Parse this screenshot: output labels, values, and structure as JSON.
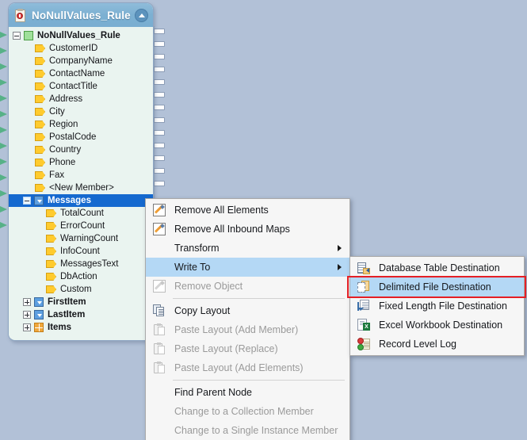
{
  "node_panel": {
    "header": {
      "title": "NoNullValues_Rule",
      "icon": "clipboard-record-icon",
      "collapse_icon": "chevron-up-icon"
    },
    "tree": [
      {
        "label": "NoNullValues_Rule",
        "icon": "green-square-icon",
        "expander": "minus",
        "depth": 0,
        "selected": false,
        "bold": true
      },
      {
        "label": "CustomerID",
        "icon": "yellow-pentagon-icon",
        "expander": "none",
        "depth": 1,
        "selected": false,
        "bold": false
      },
      {
        "label": "CompanyName",
        "icon": "yellow-pentagon-icon",
        "expander": "none",
        "depth": 1,
        "selected": false,
        "bold": false
      },
      {
        "label": "ContactName",
        "icon": "yellow-pentagon-icon",
        "expander": "none",
        "depth": 1,
        "selected": false,
        "bold": false
      },
      {
        "label": "ContactTitle",
        "icon": "yellow-pentagon-icon",
        "expander": "none",
        "depth": 1,
        "selected": false,
        "bold": false
      },
      {
        "label": "Address",
        "icon": "yellow-pentagon-icon",
        "expander": "none",
        "depth": 1,
        "selected": false,
        "bold": false
      },
      {
        "label": "City",
        "icon": "yellow-pentagon-icon",
        "expander": "none",
        "depth": 1,
        "selected": false,
        "bold": false
      },
      {
        "label": "Region",
        "icon": "yellow-pentagon-icon",
        "expander": "none",
        "depth": 1,
        "selected": false,
        "bold": false
      },
      {
        "label": "PostalCode",
        "icon": "yellow-pentagon-icon",
        "expander": "none",
        "depth": 1,
        "selected": false,
        "bold": false
      },
      {
        "label": "Country",
        "icon": "yellow-pentagon-icon",
        "expander": "none",
        "depth": 1,
        "selected": false,
        "bold": false
      },
      {
        "label": "Phone",
        "icon": "yellow-pentagon-icon",
        "expander": "none",
        "depth": 1,
        "selected": false,
        "bold": false
      },
      {
        "label": "Fax",
        "icon": "yellow-pentagon-icon",
        "expander": "none",
        "depth": 1,
        "selected": false,
        "bold": false
      },
      {
        "label": "<New Member>",
        "icon": "yellow-pentagon-icon",
        "expander": "none",
        "depth": 1,
        "selected": false,
        "bold": false
      },
      {
        "label": "Messages",
        "icon": "blue-node-icon",
        "expander": "minus",
        "depth": 1,
        "selected": true,
        "bold": true
      },
      {
        "label": "TotalCount",
        "icon": "yellow-pentagon-icon",
        "expander": "none",
        "depth": 2,
        "selected": false,
        "bold": false
      },
      {
        "label": "ErrorCount",
        "icon": "yellow-pentagon-icon",
        "expander": "none",
        "depth": 2,
        "selected": false,
        "bold": false
      },
      {
        "label": "WarningCount",
        "icon": "yellow-pentagon-icon",
        "expander": "none",
        "depth": 2,
        "selected": false,
        "bold": false
      },
      {
        "label": "InfoCount",
        "icon": "yellow-pentagon-icon",
        "expander": "none",
        "depth": 2,
        "selected": false,
        "bold": false
      },
      {
        "label": "MessagesText",
        "icon": "yellow-pentagon-icon",
        "expander": "none",
        "depth": 2,
        "selected": false,
        "bold": false
      },
      {
        "label": "DbAction",
        "icon": "yellow-pentagon-icon",
        "expander": "none",
        "depth": 2,
        "selected": false,
        "bold": false
      },
      {
        "label": "Custom",
        "icon": "yellow-pentagon-icon",
        "expander": "none",
        "depth": 2,
        "selected": false,
        "bold": false
      },
      {
        "label": "FirstItem",
        "icon": "blue-node-icon",
        "expander": "plus",
        "depth": 1,
        "selected": false,
        "bold": true
      },
      {
        "label": "LastItem",
        "icon": "blue-node-icon",
        "expander": "plus",
        "depth": 1,
        "selected": false,
        "bold": true
      },
      {
        "label": "Items",
        "icon": "orange-grid-icon",
        "expander": "plus",
        "depth": 1,
        "selected": false,
        "bold": true
      }
    ]
  },
  "context_menu": [
    {
      "label": "Remove All Elements",
      "icon": "pencil-icon",
      "disabled": false,
      "submenu": false,
      "highlighted": false,
      "separator_after": false
    },
    {
      "label": "Remove All Inbound Maps",
      "icon": "pencil-icon",
      "disabled": false,
      "submenu": false,
      "highlighted": false,
      "separator_after": false
    },
    {
      "label": "Transform",
      "icon": "none",
      "disabled": false,
      "submenu": true,
      "highlighted": false,
      "separator_after": false
    },
    {
      "label": "Write To",
      "icon": "none",
      "disabled": false,
      "submenu": true,
      "highlighted": true,
      "separator_after": false
    },
    {
      "label": "Remove Object",
      "icon": "pencil-dim-icon",
      "disabled": true,
      "submenu": false,
      "highlighted": false,
      "separator_after": true
    },
    {
      "label": "Copy Layout",
      "icon": "copy-icon",
      "disabled": false,
      "submenu": false,
      "highlighted": false,
      "separator_after": false
    },
    {
      "label": "Paste Layout (Add Member)",
      "icon": "paste-icon",
      "disabled": true,
      "submenu": false,
      "highlighted": false,
      "separator_after": false
    },
    {
      "label": "Paste Layout (Replace)",
      "icon": "paste-icon",
      "disabled": true,
      "submenu": false,
      "highlighted": false,
      "separator_after": false
    },
    {
      "label": "Paste Layout (Add Elements)",
      "icon": "paste-icon",
      "disabled": true,
      "submenu": false,
      "highlighted": false,
      "separator_after": true
    },
    {
      "label": "Find Parent Node",
      "icon": "none",
      "disabled": false,
      "submenu": false,
      "highlighted": false,
      "separator_after": false
    },
    {
      "label": "Change to a Collection Member",
      "icon": "none",
      "disabled": true,
      "submenu": false,
      "highlighted": false,
      "separator_after": false
    },
    {
      "label": "Change to a Single Instance Member",
      "icon": "none",
      "disabled": true,
      "submenu": false,
      "highlighted": false,
      "separator_after": false
    }
  ],
  "submenu": {
    "parent": "Write To",
    "items": [
      {
        "label": "Database Table Destination",
        "icon": "database-table-icon",
        "highlighted": false,
        "outlined": false
      },
      {
        "label": "Delimited File Destination",
        "icon": "delimited-file-icon",
        "highlighted": true,
        "outlined": true
      },
      {
        "label": "Fixed Length File Destination",
        "icon": "fixed-length-file-icon",
        "highlighted": false,
        "outlined": false
      },
      {
        "label": "Excel Workbook Destination",
        "icon": "excel-workbook-icon",
        "highlighted": false,
        "outlined": false
      },
      {
        "label": "Record Level Log",
        "icon": "record-level-log-icon",
        "highlighted": false,
        "outlined": false
      }
    ]
  },
  "excel_glyph": "X",
  "colors": {
    "canvas_background": "#b2c1d7",
    "panel_background": "#eaf4f0",
    "panel_header": "#7cb0d2",
    "selection_blue": "#1569cf",
    "menu_highlight": "#b4d8f5",
    "red_outline": "#e41f25"
  }
}
